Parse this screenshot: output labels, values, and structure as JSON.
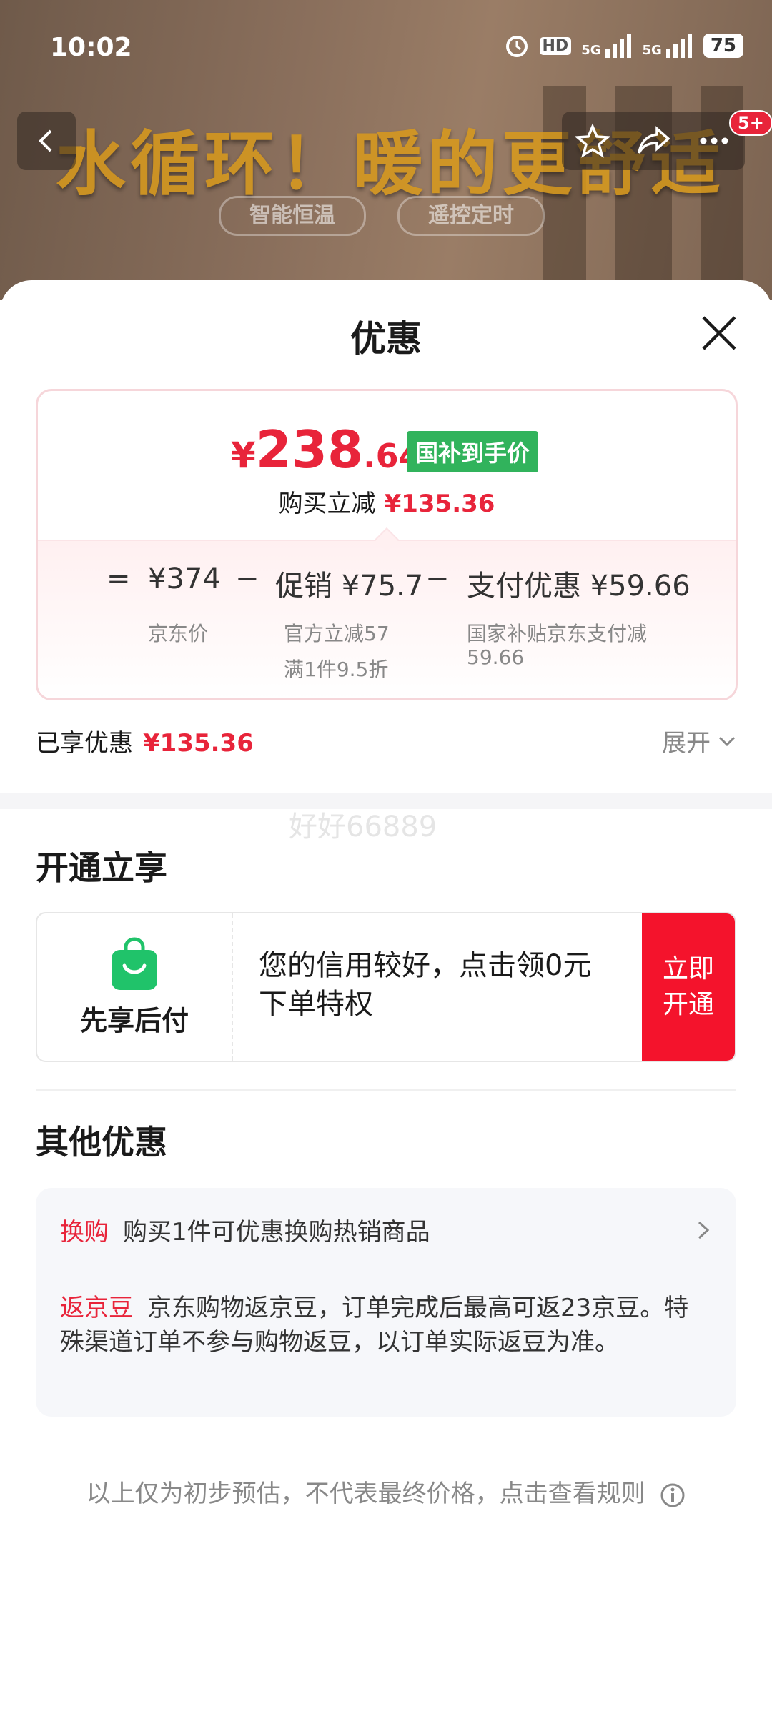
{
  "status_bar": {
    "time": "10:02",
    "hd_label": "HD",
    "net1": "5G",
    "net2": "5G",
    "battery": "75"
  },
  "banner": {
    "headline": "水循环！暖的更舒适",
    "pill1": "智能恒温",
    "pill2": "遥控定时",
    "cart_badge": "5+"
  },
  "sheet": {
    "title": "优惠"
  },
  "price_card": {
    "yen": "¥",
    "final_int": "238",
    "final_dec": ".64",
    "tag": "国补到手价",
    "reduce_label": "购买立减",
    "reduce_value": "¥135.36",
    "eq": "=",
    "base_price": "¥374",
    "minus1": "−",
    "promo": "促销 ¥75.7",
    "minus2": "−",
    "pay": "支付优惠 ¥59.66",
    "base_label": "京东价",
    "promo_sub1": "官方立减57",
    "promo_sub2": "满1件9.5折",
    "pay_sub1": "国家补贴京东支付减",
    "pay_sub2": "59.66"
  },
  "enjoyed": {
    "label": "已享优惠",
    "value": "¥135.36",
    "expand": "展开"
  },
  "watermark": "好好66889",
  "open_section": {
    "title": "开通立享",
    "card_label": "先享后付",
    "card_text": "您的信用较好，点击领0元下单特权",
    "button_line1": "立即",
    "button_line2": "开通"
  },
  "other_section": {
    "title": "其他优惠",
    "row1_tag": "换购",
    "row1_text": "购买1件可优惠换购热销商品",
    "row2_tag": "返京豆",
    "row2_text": "京东购物返京豆，订单完成后最高可返23京豆。特殊渠道订单不参与购物返豆，以订单实际返豆为准。"
  },
  "footer": {
    "text": "以上仅为初步预估，不代表最终价格，点击查看规则"
  },
  "colors": {
    "accent_red": "#e8243a",
    "button_red": "#f4132c",
    "tag_green": "#31b35c"
  }
}
